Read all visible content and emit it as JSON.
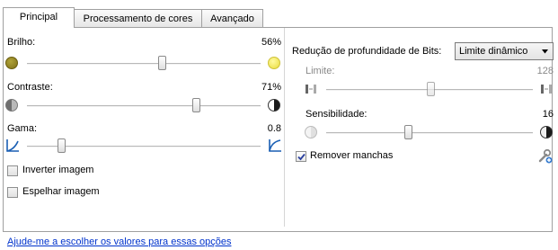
{
  "tabs": [
    {
      "label": "Principal"
    },
    {
      "label": "Processamento de cores"
    },
    {
      "label": "Avançado"
    }
  ],
  "left": {
    "brightness": {
      "label": "Brilho:",
      "value": "56%",
      "level": 0.56
    },
    "contrast": {
      "label": "Contraste:",
      "value": "71%",
      "level": 0.71
    },
    "gamma": {
      "label": "Gama:",
      "value": "0.8"
    },
    "invert_label": "Inverter imagem",
    "mirror_label": "Espelhar imagem",
    "help_link": "Ajude-me a escolher os valores para essas opções"
  },
  "right": {
    "bit_reduction_label": "Redução de profundidade de Bits:",
    "bit_reduction_value": "Limite dinâmico",
    "threshold": {
      "label": "Limite:",
      "value": "128"
    },
    "sensitivity": {
      "label": "Sensibilidade:",
      "value": "16"
    },
    "remove_spots_label": "Remover manchas",
    "remove_spots_checked": true
  },
  "colors": {
    "brightness_dark": "#8a7a1e",
    "brightness_light": "#f1ea5a",
    "link": "#0033cc"
  }
}
